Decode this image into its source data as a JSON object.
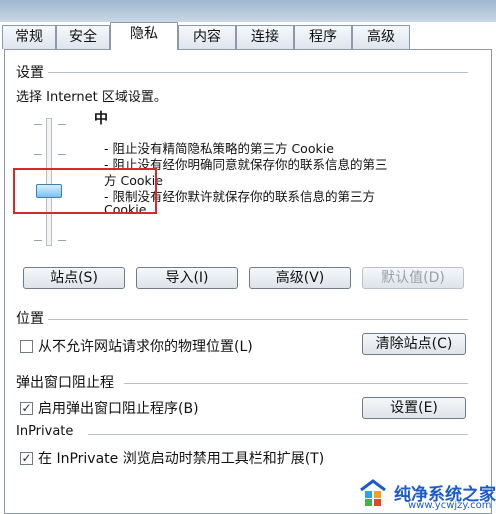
{
  "tabs": [
    {
      "label": "常规"
    },
    {
      "label": "安全"
    },
    {
      "label": "隐私"
    },
    {
      "label": "内容"
    },
    {
      "label": "连接"
    },
    {
      "label": "程序"
    },
    {
      "label": "高级"
    }
  ],
  "active_tab": "隐私",
  "settings": {
    "title": "设置",
    "instruction": "选择 Internet 区域设置。",
    "level": "中",
    "desc_lines": [
      "- 阻止没有精简隐私策略的第三方 Cookie",
      "- 阻止没有经你明确同意就保存你的联系信息的第三",
      "方 Cookie",
      "- 限制没有经你默许就保存你的联系信息的第三方",
      "Cookie"
    ],
    "buttons": {
      "sites": "站点(S)",
      "import": "导入(I)",
      "advanced": "高级(V)",
      "default": "默认值(D)"
    }
  },
  "location": {
    "title": "位置",
    "checkbox_label": "从不允许网站请求你的物理位置(L)",
    "checked": false,
    "clear_button": "清除站点(C)"
  },
  "popup": {
    "title": "弹出窗口阻止程",
    "checkbox_label": "启用弹出窗口阻止程序(B)",
    "checked": true,
    "settings_button": "设置(E)"
  },
  "inprivate": {
    "title": "InPrivate",
    "checkbox_label": "在 InPrivate 浏览启动时禁用工具栏和扩展(T)",
    "checked": true
  },
  "watermark": {
    "name": "纯净系统之家",
    "url": "www.ycwjzy.com"
  },
  "colors": {
    "highlight_box": "#d62a2a",
    "thumb": "#7cc1f0",
    "watermark": "#1b5bc7"
  }
}
